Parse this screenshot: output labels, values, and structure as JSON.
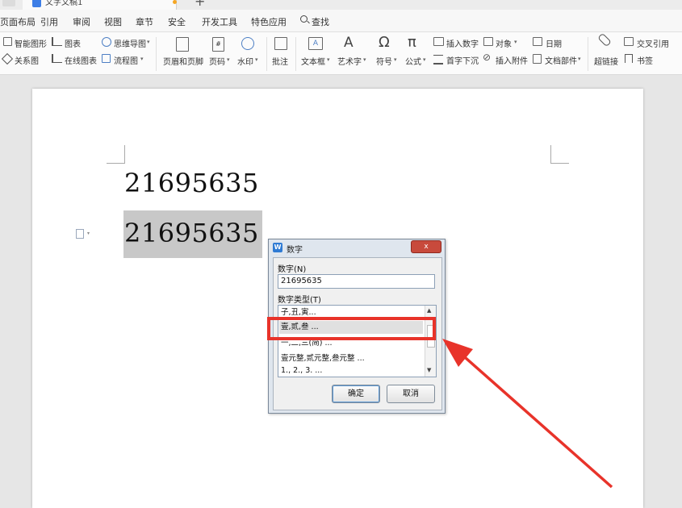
{
  "window": {
    "doc_tab_title": "文字文稿1",
    "new_tab": "+"
  },
  "menu": {
    "items": [
      "页面布局",
      "引用",
      "审阅",
      "视图",
      "章节",
      "安全",
      "开发工具",
      "特色应用"
    ],
    "search_label": "查找"
  },
  "ribbon": {
    "smart_shape": "智能图形",
    "chart": "图表",
    "mind_map": "思维导图",
    "relation_graph": "关系图",
    "online_chart": "在线图表",
    "flowchart": "流程图",
    "header_footer": "页眉和页脚",
    "page_number": "页码",
    "watermark": "水印",
    "comment": "批注",
    "text_box": "文本框",
    "word_art": "艺术字",
    "symbol": "符号",
    "formula": "公式",
    "insert_number": "插入数字",
    "object": "对象",
    "date": "日期",
    "drop_cap": "首字下沉",
    "insert_attachment": "插入附件",
    "doc_parts": "文档部件",
    "hyperlink": "超链接",
    "cross_reference": "交叉引用",
    "bookmark": "书签"
  },
  "document": {
    "line1": "21695635",
    "line2": "21695635"
  },
  "dialog": {
    "title": "数字",
    "close": "x",
    "number_label": "数字(N)",
    "number_value": "21695635",
    "type_label": "数字类型(T)",
    "types": [
      "子,丑,寅...",
      "壹,贰,叁 ...",
      "一,二,三(简) ...",
      "壹元整,贰元整,叁元整 ...",
      "1., 2., 3. ..."
    ],
    "selected_index": 1,
    "ok": "确定",
    "cancel": "取消"
  },
  "colors": {
    "annotation": "#e8332a",
    "selection": "#c8c8c8",
    "wps_blue": "#2f7bd4"
  }
}
